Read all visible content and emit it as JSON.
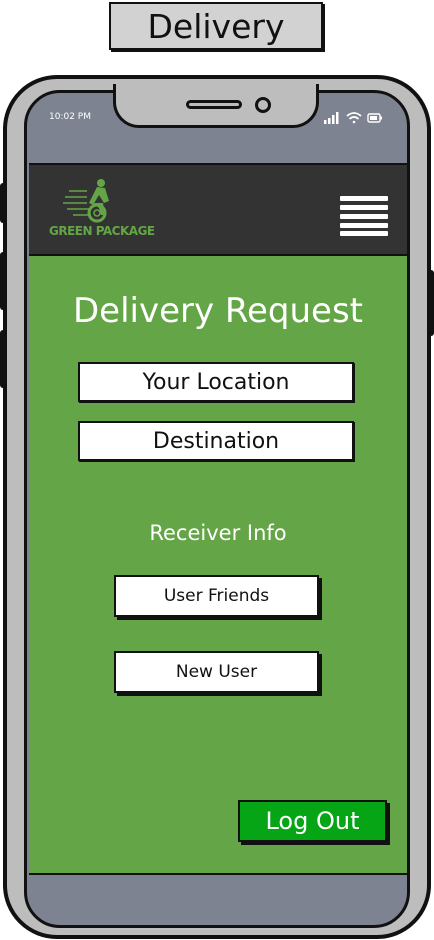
{
  "screen_title": "Delivery",
  "status_bar": {
    "time": "10:02 PM",
    "icons": [
      "signal-icon",
      "wifi-icon",
      "battery-icon"
    ]
  },
  "header": {
    "logo_text": "GREEN PACKAGE",
    "logo_icon": "cyclist-icon",
    "menu_icon": "hamburger-menu-icon"
  },
  "main": {
    "heading": "Delivery Request",
    "location_field": "Your Location",
    "destination_field": "Destination",
    "receiver_label": "Receiver Info",
    "user_friends_button": "User Friends",
    "new_user_button": "New User",
    "logout_button": "Log Out"
  },
  "colors": {
    "app_background": "#64a547",
    "navbar": "#333333",
    "logout_button": "#05a516",
    "phone_frame": "#bdbdbd",
    "screen_border": "#7d8390"
  }
}
